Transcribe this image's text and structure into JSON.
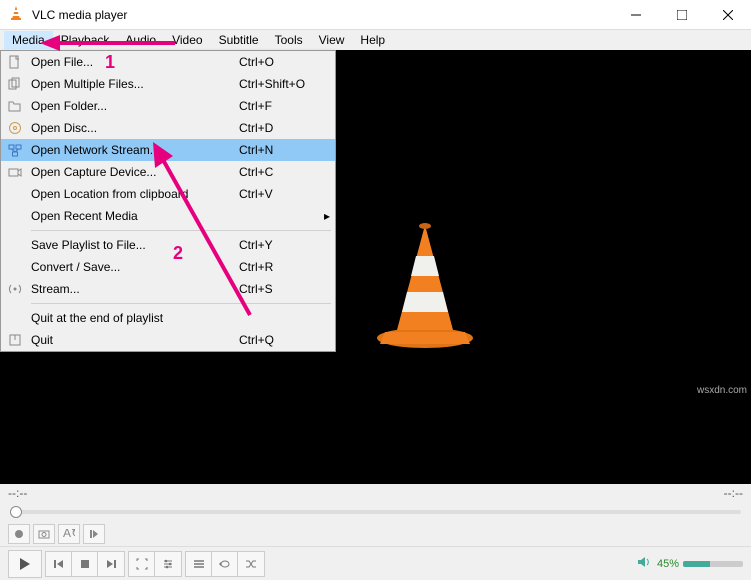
{
  "title": "VLC media player",
  "menubar": [
    "Media",
    "Playback",
    "Audio",
    "Video",
    "Subtitle",
    "Tools",
    "View",
    "Help"
  ],
  "dropdown": {
    "items": [
      {
        "label": "Open File...",
        "shortcut": "Ctrl+O",
        "icon": "file"
      },
      {
        "label": "Open Multiple Files...",
        "shortcut": "Ctrl+Shift+O",
        "icon": "files"
      },
      {
        "label": "Open Folder...",
        "shortcut": "Ctrl+F",
        "icon": "folder"
      },
      {
        "label": "Open Disc...",
        "shortcut": "Ctrl+D",
        "icon": "disc"
      },
      {
        "label": "Open Network Stream...",
        "shortcut": "Ctrl+N",
        "icon": "network",
        "highlighted": true
      },
      {
        "label": "Open Capture Device...",
        "shortcut": "Ctrl+C",
        "icon": "capture"
      },
      {
        "label": "Open Location from clipboard",
        "shortcut": "Ctrl+V",
        "icon": ""
      },
      {
        "label": "Open Recent Media",
        "shortcut": "",
        "icon": "",
        "submenu": true
      }
    ],
    "items2": [
      {
        "label": "Save Playlist to File...",
        "shortcut": "Ctrl+Y",
        "icon": ""
      },
      {
        "label": "Convert / Save...",
        "shortcut": "Ctrl+R",
        "icon": ""
      },
      {
        "label": "Stream...",
        "shortcut": "Ctrl+S",
        "icon": "stream"
      }
    ],
    "items3": [
      {
        "label": "Quit at the end of playlist",
        "shortcut": "",
        "icon": ""
      },
      {
        "label": "Quit",
        "shortcut": "Ctrl+Q",
        "icon": "quit"
      }
    ]
  },
  "status": {
    "left": "--:--",
    "right": "--:--"
  },
  "volume": {
    "pct": "45%"
  },
  "annotations": {
    "a1": "1",
    "a2": "2"
  },
  "watermark": "wsxdn.com"
}
